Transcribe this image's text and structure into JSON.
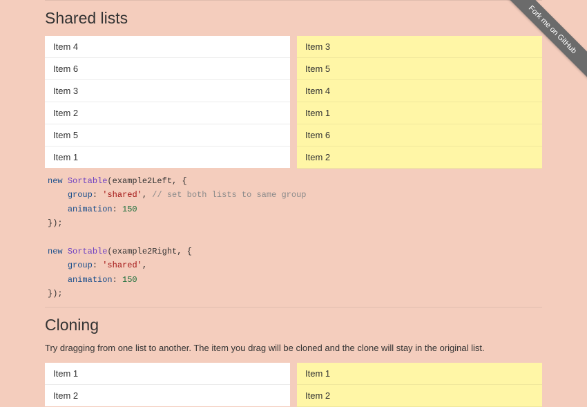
{
  "ribbon": {
    "label": "Fork me on GitHub"
  },
  "shared": {
    "title": "Shared lists",
    "left": [
      "Item 4",
      "Item 6",
      "Item 3",
      "Item 2",
      "Item 5",
      "Item 1"
    ],
    "right": [
      "Item 3",
      "Item 5",
      "Item 4",
      "Item 1",
      "Item 6",
      "Item 2"
    ],
    "code": {
      "kw_new": "new",
      "fn": "Sortable",
      "arg_left": "example2Left",
      "arg_right": "example2Right",
      "key_group": "group",
      "val_group": "'shared'",
      "cmt": "// set both lists to same group",
      "key_anim": "animation",
      "val_anim": "150",
      "brace_open": "{",
      "brace_close": "});",
      "comma": ", ",
      "colon": ": ",
      "paren_open": "("
    }
  },
  "cloning": {
    "title": "Cloning",
    "desc": "Try dragging from one list to another. The item you drag will be cloned and the clone will stay in the original list.",
    "left": [
      "Item 1",
      "Item 2"
    ],
    "right": [
      "Item 1",
      "Item 2"
    ]
  }
}
